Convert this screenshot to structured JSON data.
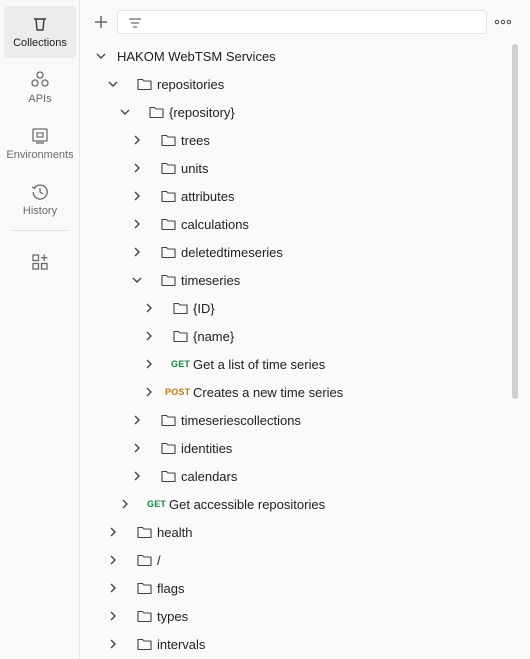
{
  "rail": {
    "collections_label": "Collections",
    "apis_label": "APIs",
    "environments_label": "Environments",
    "history_label": "History"
  },
  "toolbar": {
    "filter_placeholder": "",
    "add_icon": "plus-icon",
    "filter_icon": "filter-icon",
    "more_icon": "ellipsis-icon"
  },
  "tree": {
    "collection": "HAKOM WebTSM Services",
    "repositories": "repositories",
    "repository": "{repository}",
    "trees": "trees",
    "units": "units",
    "attributes": "attributes",
    "calculations": "calculations",
    "deletedtimeseries": "deletedtimeseries",
    "timeseries": "timeseries",
    "id": "{ID}",
    "name": "{name}",
    "list_method": "GET",
    "list_label": "Get a list of time series",
    "create_method": "POST",
    "create_label": "Creates a new time series",
    "timeseriescollections": "timeseriescollections",
    "identities": "identities",
    "calendars": "calendars",
    "access_method": "GET",
    "access_label": "Get accessible repositories",
    "health": "health",
    "root": "/",
    "flags": "flags",
    "types": "types",
    "intervals": "intervals"
  },
  "colors": {
    "get": "#0f8a3a",
    "post": "#b97b06",
    "active_rail_bg": "#ececec"
  }
}
